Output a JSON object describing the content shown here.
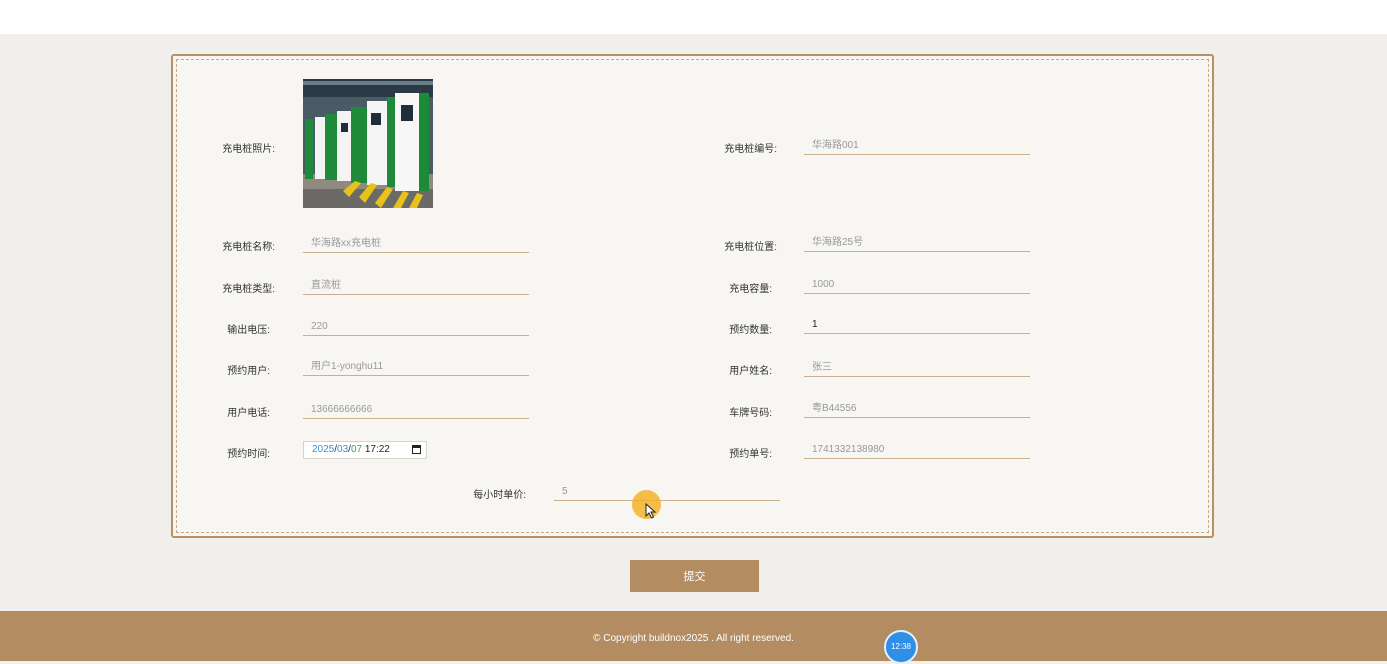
{
  "form": {
    "photo_label": "充电桩照片:",
    "code_label": "充电桩编号:",
    "code_value": "华海路001",
    "name_label": "充电桩名称:",
    "name_value": "华海路xx充电桩",
    "location_label": "充电桩位置:",
    "location_value": "华海路25号",
    "type_label": "充电桩类型:",
    "type_value": "直流桩",
    "capacity_label": "充电容量:",
    "capacity_value": "1000",
    "voltage_label": "输出电压:",
    "voltage_value": "220",
    "quantity_label": "预约数量:",
    "quantity_value": "1",
    "user_label": "预约用户:",
    "user_value": "用户1-yonghu11",
    "username_label": "用户姓名:",
    "username_value": "张三",
    "phone_label": "用户电话:",
    "phone_value": "13666666666",
    "plate_label": "车牌号码:",
    "plate_value": "粤B44556",
    "time_label": "预约时间:",
    "time_year": "2025",
    "time_month": "03",
    "time_day": "07",
    "time_clock": "17:22",
    "order_label": "预约单号:",
    "order_value": "1741332138980",
    "price_label": "每小时单价:",
    "price_value": "5"
  },
  "submit_label": "提交",
  "footer_text": "© Copyright buildnox2025 . All right reserved.",
  "clock_badge": "12:38",
  "colors": {
    "accent": "#b38c62",
    "border": "#b98f64"
  }
}
